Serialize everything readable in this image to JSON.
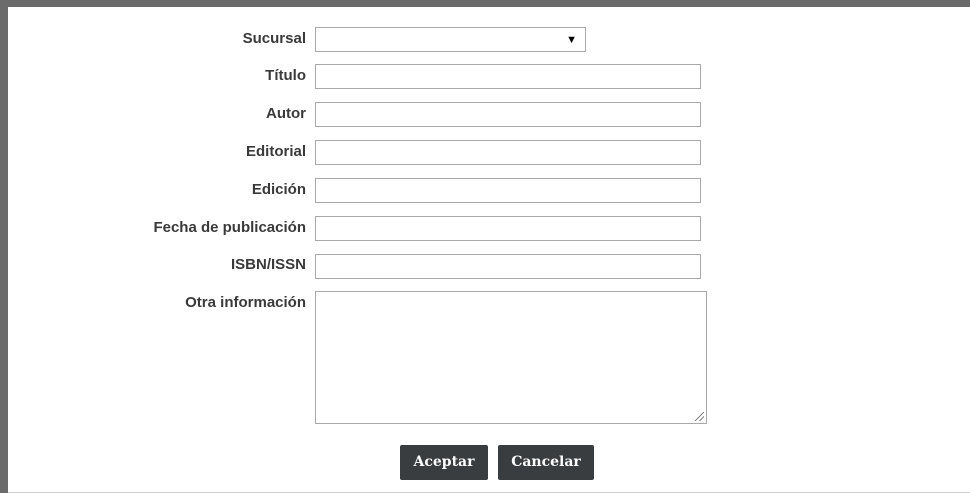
{
  "form": {
    "sucursal": {
      "label": "Sucursal",
      "value": ""
    },
    "titulo": {
      "label": "Título",
      "value": ""
    },
    "autor": {
      "label": "Autor",
      "value": ""
    },
    "editorial": {
      "label": "Editorial",
      "value": ""
    },
    "edicion": {
      "label": "Edición",
      "value": ""
    },
    "fecha": {
      "label": "Fecha de publicación",
      "value": ""
    },
    "isbn": {
      "label": "ISBN/ISSN",
      "value": ""
    },
    "otra": {
      "label": "Otra información",
      "value": ""
    }
  },
  "buttons": {
    "accept_label": "Aceptar",
    "cancel_label": "Cancelar"
  },
  "icons": {
    "dropdown": "chevron-down-icon",
    "resize": "resize-handle-icon"
  },
  "colors": {
    "button_bg": "#3a3d40",
    "button_text": "#ffffff",
    "label_text": "#3a3a3a",
    "border": "#a9a9a9"
  }
}
